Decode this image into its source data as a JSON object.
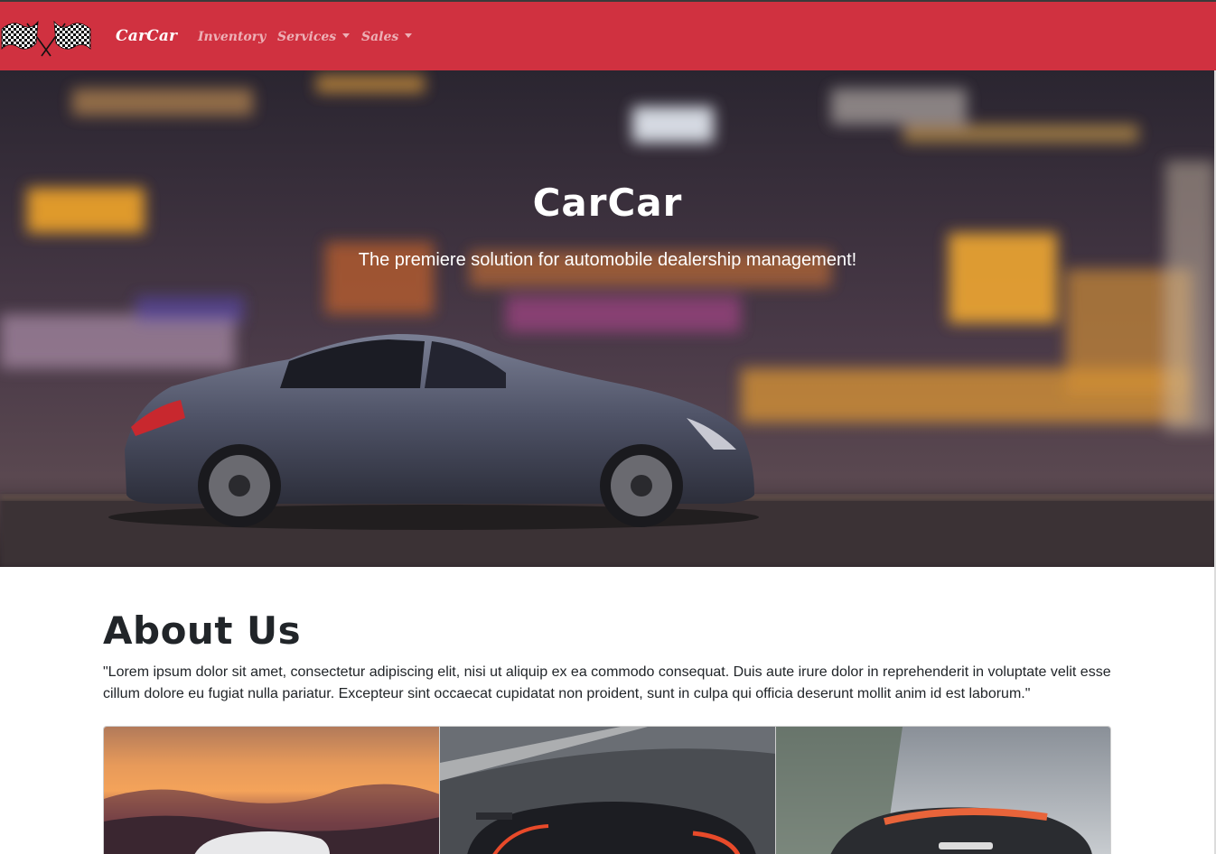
{
  "navbar": {
    "brand": "CarCar",
    "links": [
      {
        "label": "Inventory",
        "dropdown": false
      },
      {
        "label": "Services",
        "dropdown": true
      },
      {
        "label": "Sales",
        "dropdown": true
      }
    ],
    "logo_icon": "checkered-flags-icon",
    "background_color": "#d03140"
  },
  "hero": {
    "title": "CarCar",
    "subtitle": "The premiere solution for automobile dealership management!"
  },
  "about": {
    "title": "About Us",
    "text": "\"Lorem ipsum dolor sit amet, consectetur adipiscing elit, nisi ut aliquip ex ea commodo consequat. Duis aute irure dolor in reprehenderit in voluptate velit esse cillum dolore eu fugiat nulla pariatur. Excepteur sint occaecat cupidatat non proident, sunt in culpa qui officia deserunt mollit anim id est laborum.\""
  },
  "gallery": {
    "images": [
      "sunset-car-photo",
      "black-supercar-photo",
      "racing-supercar-photo"
    ]
  }
}
